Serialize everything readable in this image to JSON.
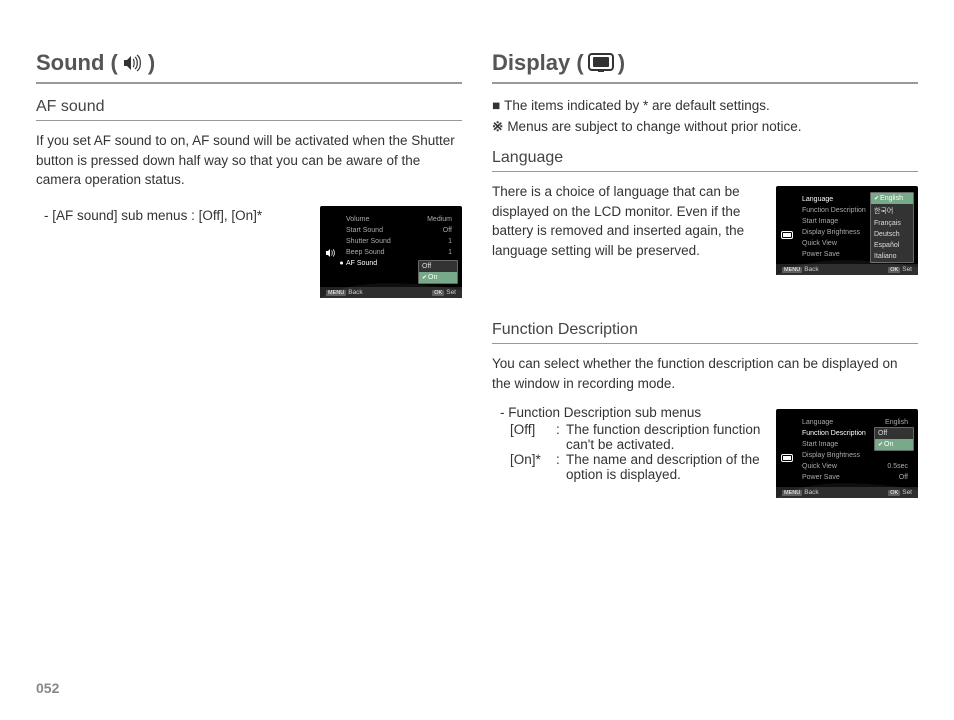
{
  "page_number": "052",
  "left": {
    "title_prefix": "Sound (",
    "title_suffix": ")",
    "af_sound": {
      "heading": "AF sound",
      "body": "If you set AF sound to on, AF sound will be activated when the Shutter button is pressed down half way so that you can be aware of the camera operation status.",
      "submenus": "- [AF sound] sub menus : [Off], [On]*"
    },
    "menu": {
      "rows": [
        {
          "label": "Volume",
          "value": "Medium"
        },
        {
          "label": "Start Sound",
          "value": "Off"
        },
        {
          "label": "Shutter Sound",
          "value": "1"
        },
        {
          "label": "Beep Sound",
          "value": "1"
        },
        {
          "label": "AF Sound",
          "value": ""
        }
      ],
      "popup": {
        "off": "Off",
        "on": "On"
      },
      "footer": {
        "menu": "MENU",
        "back": "Back",
        "ok": "OK",
        "set": "Set"
      }
    }
  },
  "right": {
    "title_prefix": "Display (",
    "title_suffix": ")",
    "notes": {
      "n1": "The items indicated by * are default settings.",
      "n2": "Menus are subject to change without prior notice."
    },
    "language": {
      "heading": "Language",
      "body": "There is a choice of language that can be displayed on the LCD monitor. Even if the battery is removed and inserted again, the language setting will be preserved.",
      "menu": {
        "rows": [
          {
            "label": "Language",
            "value": ""
          },
          {
            "label": "Function Description",
            "value": ""
          },
          {
            "label": "Start Image",
            "value": ""
          },
          {
            "label": "Display Brightness",
            "value": ""
          },
          {
            "label": "Quick View",
            "value": ""
          },
          {
            "label": "Power Save",
            "value": ""
          }
        ],
        "popup": [
          "English",
          "한국어",
          "Français",
          "Deutsch",
          "Español",
          "Italiano"
        ]
      }
    },
    "function_desc": {
      "heading": "Function Description",
      "body": "You can select whether the function description can be displayed on the window in recording mode.",
      "list": {
        "head": "- Function Description sub menus",
        "off_key": "[Off]",
        "off_val": "The function description function can't be activated.",
        "on_key": "[On]*",
        "on_val": "The name and description of the option is displayed."
      },
      "menu": {
        "rows": [
          {
            "label": "Language",
            "value": "English"
          },
          {
            "label": "Function Description",
            "value": ""
          },
          {
            "label": "Start Image",
            "value": ""
          },
          {
            "label": "Display Brightness",
            "value": ""
          },
          {
            "label": "Quick View",
            "value": "0.5sec"
          },
          {
            "label": "Power Save",
            "value": "Off"
          }
        ],
        "popup": {
          "off": "Off",
          "on": "On"
        }
      }
    },
    "footer": {
      "menu": "MENU",
      "back": "Back",
      "ok": "OK",
      "set": "Set"
    }
  }
}
